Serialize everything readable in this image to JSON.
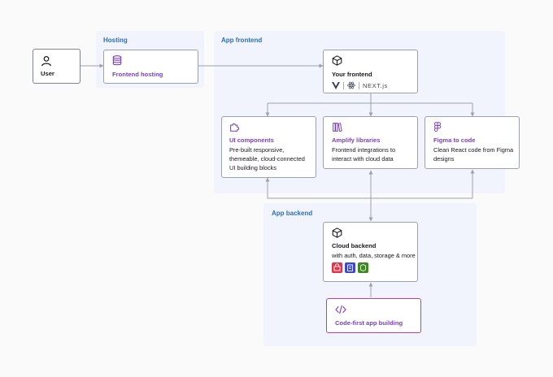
{
  "regions": {
    "hosting": "Hosting",
    "app_frontend": "App frontend",
    "app_backend": "App backend"
  },
  "nodes": {
    "user": {
      "title": "User",
      "icon": "user-icon"
    },
    "frontend_hosting": {
      "title": "Frontend hosting",
      "icon": "database-icon"
    },
    "your_frontend": {
      "title": "Your frontend",
      "icon": "cube-icon",
      "logos": [
        "vue-logo-icon",
        "react-logo-icon",
        "nextjs-logo-icon"
      ],
      "next_text": "NEXT.js"
    },
    "ui_components": {
      "title": "UI components",
      "desc_lines": [
        "Pre-built responsive,",
        "themeable, cloud-connected",
        "UI building blocks"
      ],
      "icon": "puzzle-icon"
    },
    "amplify_libraries": {
      "title": "Amplify libraries",
      "desc_lines": [
        "Frontend integrations to",
        "interact with cloud data"
      ],
      "icon": "books-icon"
    },
    "figma_to_code": {
      "title": "Figma to code",
      "desc_lines": [
        "Clean React code from Figma",
        "designs"
      ],
      "icon": "figma-icon"
    },
    "cloud_backend": {
      "title": "Cloud backend",
      "desc_lines": [
        "with auth, data, storage & more"
      ],
      "icon": "cube-icon",
      "services": [
        "auth-service-icon",
        "data-service-icon",
        "storage-service-icon"
      ]
    },
    "code_first": {
      "title": "Code-first app building",
      "icon": "code-icon"
    }
  },
  "colors": {
    "region_bg": "#f1f4fd",
    "region_label": "#2a6fb5",
    "accent_purple": "#7b3fbf",
    "code_border": "#c23aa8",
    "arrow": "#9aa2ad",
    "svc_red": "#dd344c",
    "svc_blue": "#3b48cc",
    "svc_green": "#3f8624"
  }
}
